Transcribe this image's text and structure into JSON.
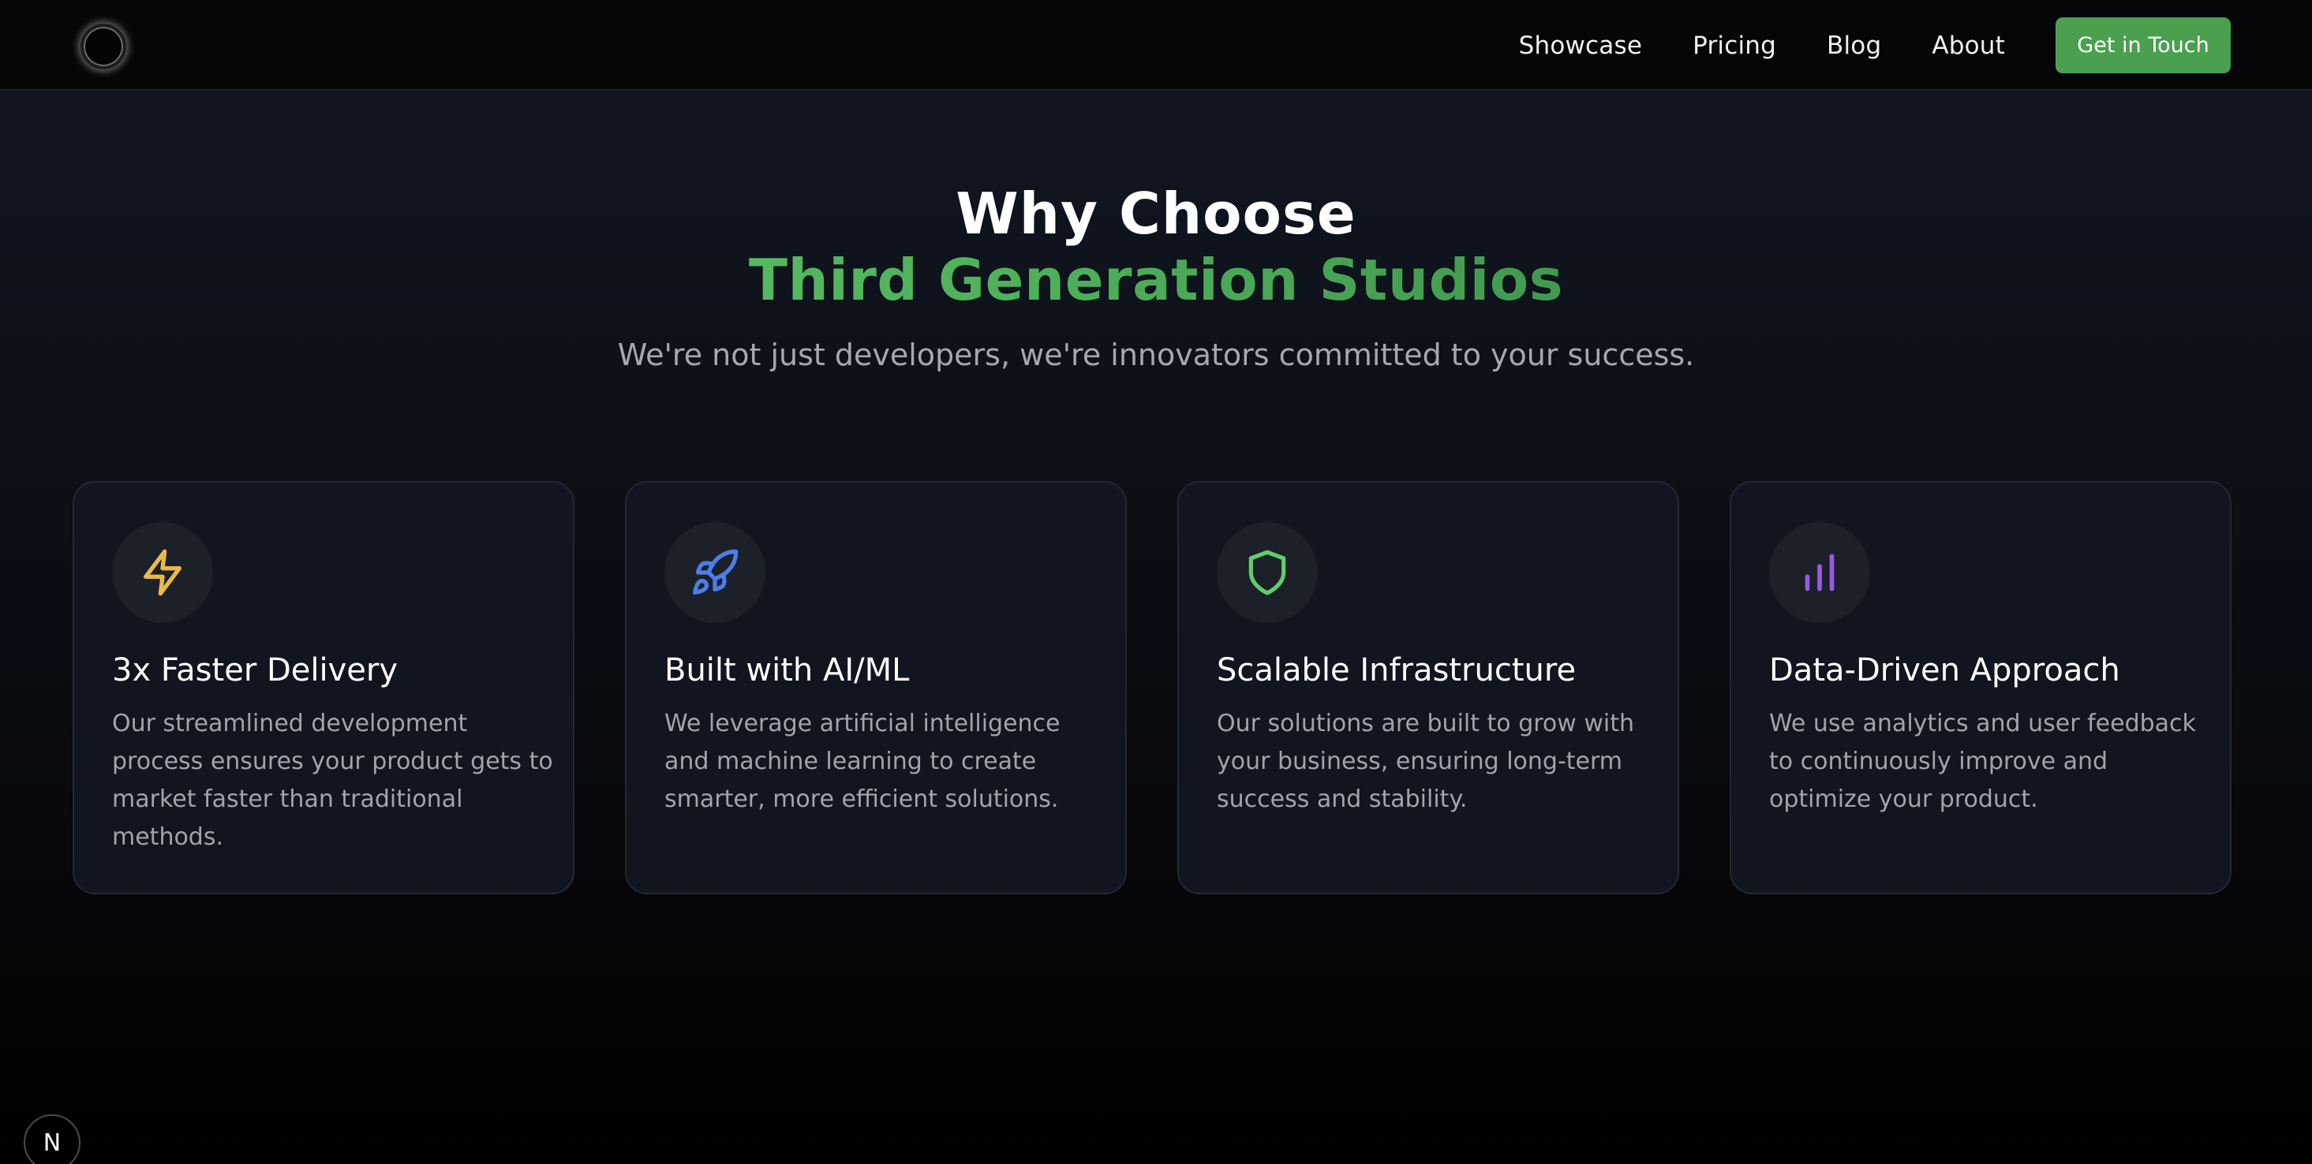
{
  "nav": {
    "links": [
      "Showcase",
      "Pricing",
      "Blog",
      "About"
    ],
    "cta_label": "Get in Touch"
  },
  "hero": {
    "title_line1": "Why Choose",
    "title_line2": "Third Generation Studios",
    "subtitle": "We're not just developers, we're innovators committed to your success."
  },
  "features": [
    {
      "icon": "lightning-icon",
      "icon_color": "#e9b949",
      "title": "3x Faster Delivery",
      "description": "Our streamlined development process ensures your product gets to market faster than traditional methods."
    },
    {
      "icon": "rocket-icon",
      "icon_color": "#4c7ee8",
      "title": "Built with AI/ML",
      "description": "We leverage artificial intelligence and machine learning to create smarter, more efficient solutions."
    },
    {
      "icon": "shield-icon",
      "icon_color": "#5fcf6a",
      "title": "Scalable Infrastructure",
      "description": "Our solutions are built to grow with your business, ensuring long-term success and stability."
    },
    {
      "icon": "bar-chart-icon",
      "icon_color": "#9b57e6",
      "title": "Data-Driven Approach",
      "description": "We use analytics and user feedback to continuously improve and optimize your product."
    }
  ],
  "dev_badge": {
    "label": "N"
  },
  "colors": {
    "accent": "#4aa04e",
    "background": "#0b0f16",
    "card": "#101520"
  }
}
